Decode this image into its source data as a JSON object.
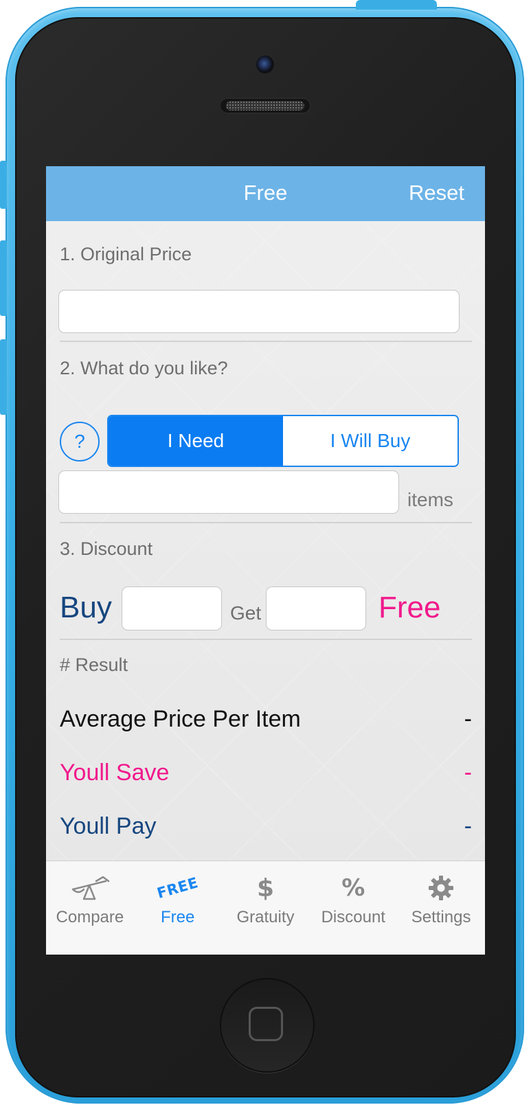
{
  "nav": {
    "title": "Free",
    "reset_label": "Reset"
  },
  "sections": {
    "original_price": {
      "label": "1. Original Price",
      "value": ""
    },
    "like": {
      "label": "2. What do you like?",
      "help_label": "?",
      "options": [
        "I Need",
        "I Will Buy"
      ],
      "selected": "I Need",
      "items_value": "",
      "items_label": "items"
    },
    "discount": {
      "label": "3. Discount",
      "buy_label": "Buy",
      "get_label": "Get",
      "free_label": "Free",
      "buy_value": "",
      "get_value": ""
    },
    "result": {
      "label": "# Result",
      "rows": [
        {
          "label": "Average Price Per Item",
          "value": "-"
        },
        {
          "label": "Youll Save",
          "value": "-"
        },
        {
          "label": "Youll Pay",
          "value": "-"
        }
      ]
    }
  },
  "tabs": [
    {
      "label": "Compare",
      "icon": "scale-icon"
    },
    {
      "label": "Free",
      "icon": "free-stamp-icon",
      "text": "FREE"
    },
    {
      "label": "Gratuity",
      "icon": "dollar-icon",
      "text": "$"
    },
    {
      "label": "Discount",
      "icon": "percent-icon",
      "text": "%"
    },
    {
      "label": "Settings",
      "icon": "gear-icon"
    }
  ],
  "active_tab": "Free",
  "colors": {
    "nav_bar": "#6cb3e7",
    "accent": "#1a86f0",
    "buy_navy": "#16467f",
    "free_pink": "#f1198c",
    "device_frame": "#36aee6"
  }
}
